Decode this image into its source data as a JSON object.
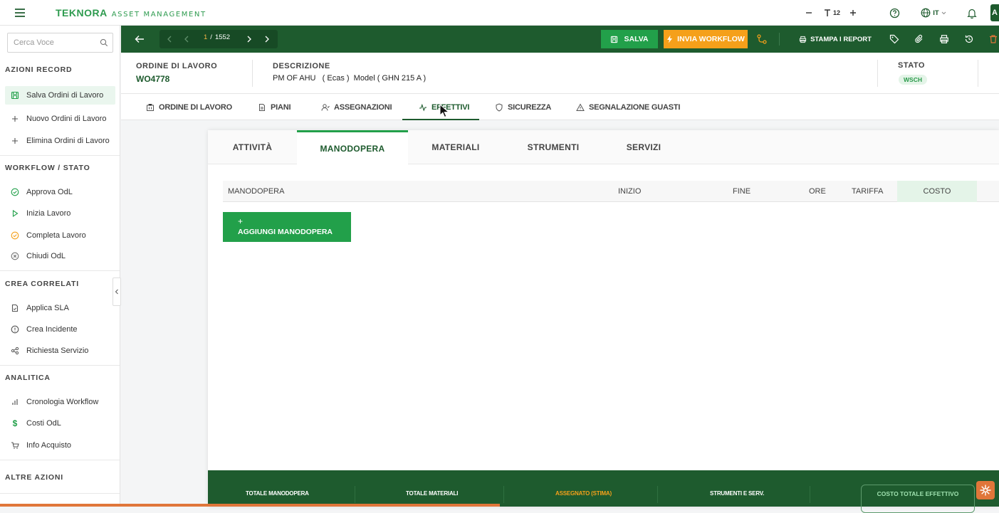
{
  "topbar": {
    "brand": "TEKNORA",
    "subtitle": "ASSET MANAGEMENT",
    "font_size_value": "12",
    "language": "IT",
    "avatar_initial": "A"
  },
  "sidebar": {
    "search_placeholder": "Cerca Voce",
    "sections": [
      {
        "title": "AZIONI RECORD",
        "items": [
          "Salva Ordini di Lavoro",
          "Nuovo Ordini di Lavoro",
          "Elimina Ordini di Lavoro"
        ]
      },
      {
        "title": "WORKFLOW / STATO",
        "items": [
          "Approva OdL",
          "Inizia Lavoro",
          "Completa Lavoro",
          "Chiudi OdL"
        ]
      },
      {
        "title": "CREA CORRELATI",
        "items": [
          "Applica SLA",
          "Crea Incidente",
          "Richiesta Servizio"
        ]
      },
      {
        "title": "ANALITICA",
        "items": [
          "Cronologia Workflow",
          "Costi OdL",
          "Info Acquisto"
        ]
      },
      {
        "title": "ALTRE AZIONI",
        "items": []
      }
    ]
  },
  "toolbar": {
    "pager_current": "1",
    "pager_sep": "/",
    "pager_total": "1552",
    "save_label": "SALVA",
    "workflow_label": "INVIA WORKFLOW",
    "report_label": "STAMPA I REPORT"
  },
  "header": {
    "wo_label": "ORDINE DI LAVORO",
    "wo_value": "WO4778",
    "desc_label": "DESCRIZIONE",
    "desc_value": "PM OF AHU   ( Ecas )  Model ( GHN 215 A )",
    "status_label": "STATO",
    "status_value": "WSCH"
  },
  "tabs": [
    {
      "label": "ORDINE DI LAVORO",
      "icon": "building-icon"
    },
    {
      "label": "PIANI",
      "icon": "document-icon"
    },
    {
      "label": "ASSEGNAZIONI",
      "icon": "user-icon"
    },
    {
      "label": "EFFETTIVI",
      "icon": "activity-icon",
      "active": true
    },
    {
      "label": "SICUREZZA",
      "icon": "shield-icon"
    },
    {
      "label": "SEGNALAZIONE GUASTI",
      "icon": "warning-icon"
    }
  ],
  "subtabs": [
    "ATTIVITÀ",
    "MANODOPERA",
    "MATERIALI",
    "STRUMENTI",
    "SERVIZI"
  ],
  "table": {
    "columns": [
      "MANODOPERA",
      "INIZIO",
      "FINE",
      "ORE",
      "TARIFFA",
      "COSTO"
    ]
  },
  "add_button": {
    "plus": "+",
    "label": "AGGIUNGI MANODOPERA"
  },
  "footer": {
    "cells": [
      "TOTALE MANODOPERA",
      "TOTALE MATERIALI",
      "ASSEGNATO (STIMA)",
      "STRUMENTI E SERV."
    ],
    "total_label": "COSTO TOTALE EFFETTIVO"
  },
  "colors": {
    "primary": "#1e5b2e",
    "accent": "#22a04a",
    "warning": "#f5a01a",
    "orange": "#e0763a"
  }
}
